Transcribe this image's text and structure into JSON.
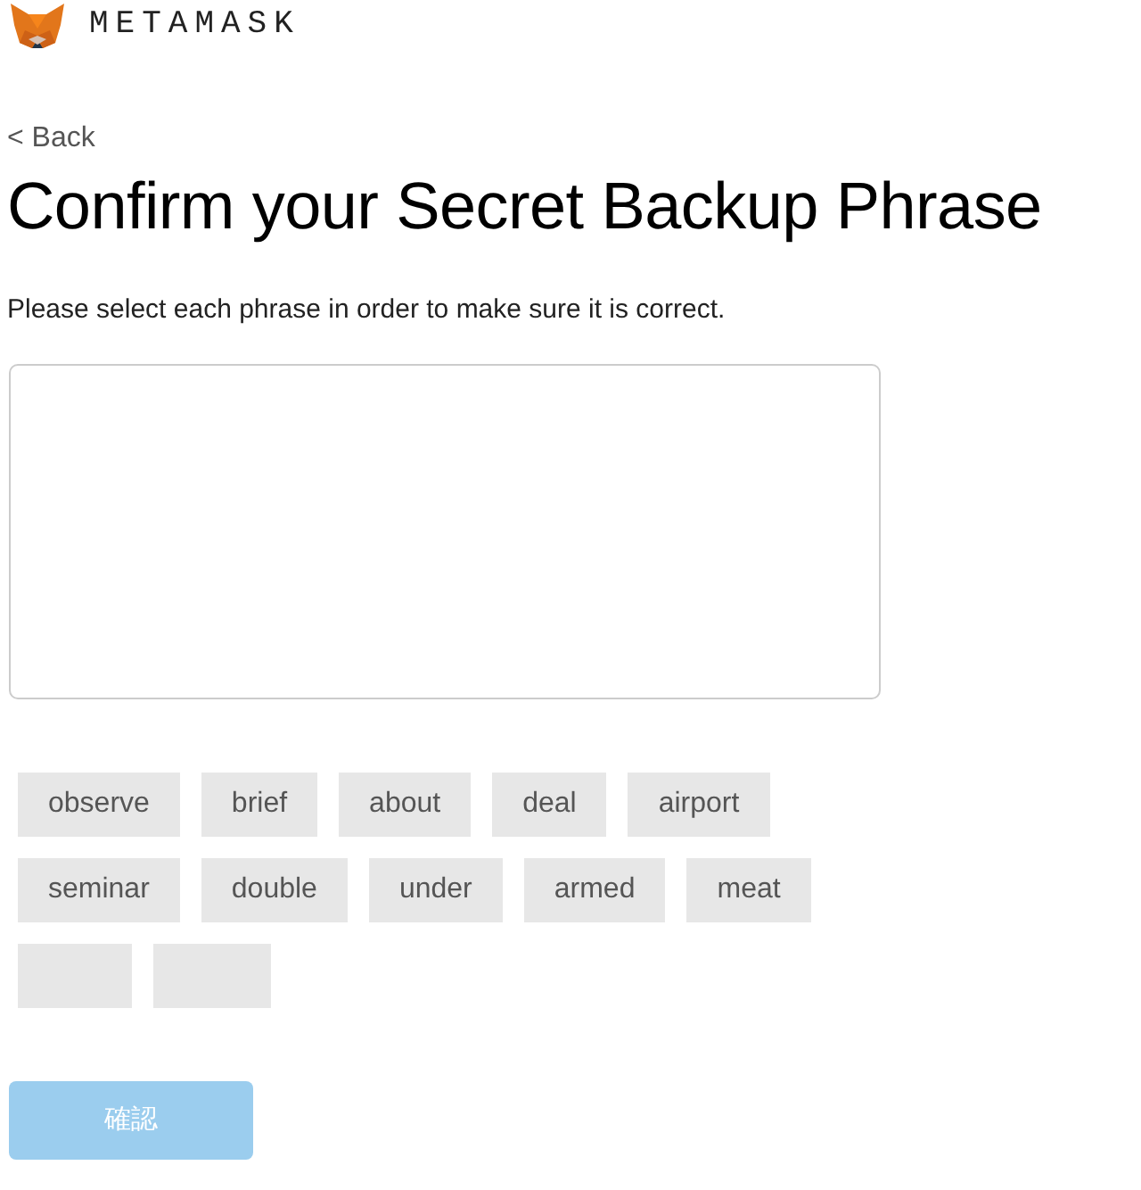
{
  "brand": "METAMASK",
  "back": "< Back",
  "title": "Confirm your Secret Backup Phrase",
  "instructions": "Please select each phrase in order to make sure it is correct.",
  "words": [
    {
      "kind": "word",
      "text": "observe"
    },
    {
      "kind": "word",
      "text": "brief"
    },
    {
      "kind": "word",
      "text": "about"
    },
    {
      "kind": "word",
      "text": "deal"
    },
    {
      "kind": "word",
      "text": "airport"
    },
    {
      "kind": "word",
      "text": "seminar"
    },
    {
      "kind": "word",
      "text": "double"
    },
    {
      "kind": "word",
      "text": "under"
    },
    {
      "kind": "word",
      "text": "armed"
    },
    {
      "kind": "word",
      "text": "meat"
    },
    {
      "kind": "blank"
    },
    {
      "kind": "blank"
    }
  ],
  "confirm_button": {
    "label": "確認",
    "disabled": true
  }
}
